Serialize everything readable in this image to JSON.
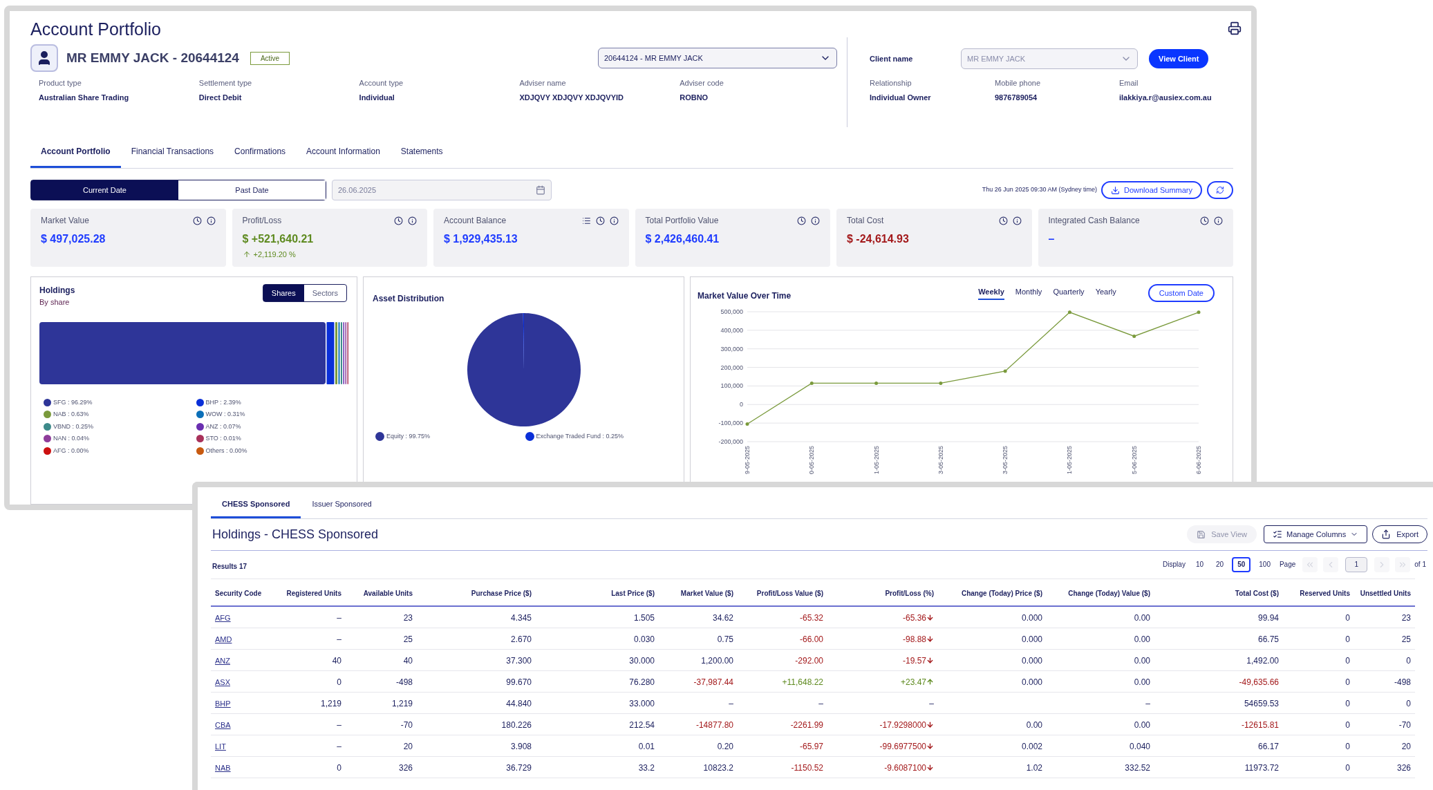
{
  "window": {
    "title": "Account Portfolio"
  },
  "account": {
    "name": "MR EMMY JACK - 20644124",
    "status": "Active",
    "selector": "20644124 - MR EMMY JACK"
  },
  "details": [
    {
      "label": "Product type",
      "value": "Australian Share Trading"
    },
    {
      "label": "Settlement type",
      "value": "Direct Debit"
    },
    {
      "label": "Account type",
      "value": "Individual"
    },
    {
      "label": "Adviser name",
      "value": "XDJQVY XDJQVY XDJQVYID"
    },
    {
      "label": "Adviser code",
      "value": "ROBNO"
    }
  ],
  "client": {
    "label": "Client name",
    "selector": "MR EMMY JACK",
    "button": "View Client",
    "details": [
      {
        "label": "Relationship",
        "value": "Individual Owner"
      },
      {
        "label": "Mobile phone",
        "value": "9876789054"
      },
      {
        "label": "Email",
        "value": "ilakkiya.r@ausiex.com.au"
      }
    ]
  },
  "tabs": [
    {
      "label": "Account Portfolio",
      "selected": true
    },
    {
      "label": "Financial Transactions",
      "selected": false
    },
    {
      "label": "Confirmations",
      "selected": false
    },
    {
      "label": "Account Information",
      "selected": false
    },
    {
      "label": "Statements",
      "selected": false
    }
  ],
  "date_mode": [
    {
      "label": "Current Date",
      "selected": true
    },
    {
      "label": "Past Date",
      "selected": false
    }
  ],
  "date_field": {
    "value": "26.06.2025",
    "disabled": true
  },
  "timestamp": "Thu 26 Jun 2025 09:30 AM (Sydney time)",
  "download_button": "Download Summary",
  "summary_cards": [
    {
      "label": "Market Value",
      "value": "$ 497,025.28",
      "color": "#1f3cff",
      "breakdown": false
    },
    {
      "label": "Profit/Loss",
      "value": "$ +521,640.21",
      "color": "#5e8a1f",
      "breakdown": false,
      "change": {
        "text": "+2,119.20 %",
        "trend_up": true
      }
    },
    {
      "label": "Account Balance",
      "value": "$ 1,929,435.13",
      "color": "#1f3cff",
      "breakdown": true
    },
    {
      "label": "Total Portfolio Value",
      "value": "$ 2,426,460.41",
      "color": "#1f3cff",
      "breakdown": false
    },
    {
      "label": "Total Cost",
      "value": "$ -24,614.93",
      "color": "#a3191b",
      "breakdown": false
    },
    {
      "label": "Integrated Cash Balance",
      "value": "–",
      "color": "#1f3cff",
      "breakdown": false
    }
  ],
  "holdings": {
    "title": "Holdings",
    "subtitle": "By share",
    "toggle": [
      {
        "label": "Shares",
        "selected": true
      },
      {
        "label": "Sectors",
        "selected": false
      }
    ],
    "legend": [
      {
        "label": "SFG : 96.29%",
        "color": "#2e3598"
      },
      {
        "label": "BHP : 2.39%",
        "color": "#0a2fd8"
      },
      {
        "label": "NAB : 0.63%",
        "color": "#7a9a3c"
      },
      {
        "label": "WOW : 0.31%",
        "color": "#0b6fb8"
      },
      {
        "label": "VBND : 0.25%",
        "color": "#3d8a8a"
      },
      {
        "label": "ANZ : 0.07%",
        "color": "#6a2fb0"
      },
      {
        "label": "NAN : 0.04%",
        "color": "#8e3c9a"
      },
      {
        "label": "STO : 0.01%",
        "color": "#a8315a"
      },
      {
        "label": "AFG : 0.00%",
        "color": "#cc1010"
      },
      {
        "label": "Others : 0.00%",
        "color": "#c85a10"
      }
    ]
  },
  "asset_distribution": {
    "title": "Asset Distribution",
    "chart_data": {
      "type": "pie",
      "categories": [
        "Equity : 99.75%",
        "Exchange Traded Fund : 0.25%"
      ],
      "values": [
        99.75,
        0.25
      ],
      "colors": [
        "#2e3598",
        "#0a2fd8"
      ],
      "legend": true
    }
  },
  "market_value_chart": {
    "title": "Market Value Over Time",
    "periods": [
      {
        "label": "Weekly",
        "selected": true
      },
      {
        "label": "Monthly",
        "selected": false
      },
      {
        "label": "Quarterly",
        "selected": false
      },
      {
        "label": "Yearly",
        "selected": false
      }
    ],
    "custom_button": "Custom Date",
    "chart_data": {
      "type": "line",
      "grid": true,
      "categories": [
        "9-05-2025",
        "0-05-2025",
        "1-05-2025",
        "3-05-2025",
        "3-05-2025",
        "1-05-2025",
        "5-06-2025",
        "6-06-2025"
      ],
      "ylim": [
        -200000,
        500000
      ],
      "yticks": [
        {
          "value": 500000,
          "label": "500,000"
        },
        {
          "value": 400000,
          "label": "400,000"
        },
        {
          "value": 300000,
          "label": "300,000"
        },
        {
          "value": 200000,
          "label": "200,000"
        },
        {
          "value": 100000,
          "label": "100,000"
        },
        {
          "value": 0,
          "label": "0"
        },
        {
          "value": -100000,
          "label": "-100,000"
        },
        {
          "value": -200000,
          "label": "-200,000"
        }
      ],
      "series": [
        {
          "color": "#7a9a3c",
          "values": [
            -105000,
            115000,
            115000,
            115000,
            180000,
            497000,
            368000,
            497000
          ]
        }
      ]
    }
  },
  "holdings_window": {
    "tabs": [
      {
        "label": "CHESS Sponsored",
        "selected": true
      },
      {
        "label": "Issuer Sponsored",
        "selected": false
      }
    ],
    "title": "Holdings - CHESS Sponsored",
    "save_button": {
      "label": "Save View",
      "disabled": true
    },
    "manage_button": "Manage Columns",
    "export_button": "Export",
    "results": "Results 17",
    "pagination": {
      "display_label": "Display",
      "sizes": [
        {
          "label": "10",
          "selected": false
        },
        {
          "label": "20",
          "selected": false
        },
        {
          "label": "50",
          "selected": true
        },
        {
          "label": "100",
          "selected": false
        }
      ],
      "page_label": "Page",
      "page": "1",
      "total": "of 1"
    },
    "table": {
      "columns": [
        "Security Code",
        "Registered Units",
        "Available Units",
        "Purchase Price ($)",
        "Last Price ($)",
        "Market Value ($)",
        "Profit/Loss Value ($)",
        "Profit/Loss (%)",
        "Change (Today) Price ($)",
        "Change (Today) Value ($)",
        "Total Cost ($)",
        "Reserved Units",
        "Unsettled Units"
      ],
      "rows": [
        [
          "AFG",
          "–",
          "23",
          "4.345",
          "1.505",
          "34.62",
          {
            "text": "-65.32",
            "color": "#a3191b"
          },
          {
            "text": "-65.36",
            "color": "#a3191b",
            "trend_up": false
          },
          "0.000",
          "0.00",
          "99.94",
          "0",
          "23"
        ],
        [
          "AMD",
          "–",
          "25",
          "2.670",
          "0.030",
          "0.75",
          {
            "text": "-66.00",
            "color": "#a3191b"
          },
          {
            "text": "-98.88",
            "color": "#a3191b",
            "trend_up": false
          },
          "0.000",
          "0.00",
          "66.75",
          "0",
          "25"
        ],
        [
          "ANZ",
          "40",
          "40",
          "37.300",
          "30.000",
          "1,200.00",
          {
            "text": "-292.00",
            "color": "#a3191b"
          },
          {
            "text": "-19.57",
            "color": "#a3191b",
            "trend_up": false
          },
          "0.000",
          "0.00",
          "1,492.00",
          "0",
          "0"
        ],
        [
          "ASX",
          "0",
          "-498",
          "99.670",
          "76.280",
          {
            "text": "-37,987.44",
            "color": "#a3191b"
          },
          {
            "text": "+11,648.22",
            "color": "#5e8a1f"
          },
          {
            "text": "+23.47",
            "color": "#5e8a1f",
            "trend_up": true
          },
          "0.000",
          "0.00",
          {
            "text": "-49,635.66",
            "color": "#a3191b"
          },
          "0",
          "-498"
        ],
        [
          "BHP",
          "1,219",
          "1,219",
          "44.840",
          "33.000",
          "–",
          "–",
          "–",
          null,
          "–",
          "54659.53",
          "0",
          "0"
        ],
        [
          "CBA",
          "–",
          "-70",
          "180.226",
          "212.54",
          {
            "text": "-14877.80",
            "color": "#a3191b"
          },
          {
            "text": "-2261.99",
            "color": "#a3191b"
          },
          {
            "text": "-17.9298000",
            "color": "#a3191b",
            "trend_up": false
          },
          "0.00",
          "0.00",
          {
            "text": "-12615.81",
            "color": "#a3191b"
          },
          "0",
          "-70"
        ],
        [
          "LIT",
          "–",
          "20",
          "3.908",
          "0.01",
          "0.20",
          {
            "text": "-65.97",
            "color": "#a3191b"
          },
          {
            "text": "-99.6977500",
            "color": "#a3191b",
            "trend_up": false
          },
          "0.002",
          "0.040",
          "66.17",
          "0",
          "20"
        ],
        [
          "NAB",
          "0",
          "326",
          "36.729",
          "33.2",
          "10823.2",
          {
            "text": "-1150.52",
            "color": "#a3191b"
          },
          {
            "text": "-9.6087100",
            "color": "#a3191b",
            "trend_up": false
          },
          "1.02",
          "332.52",
          "11973.72",
          "0",
          "326"
        ]
      ]
    }
  }
}
